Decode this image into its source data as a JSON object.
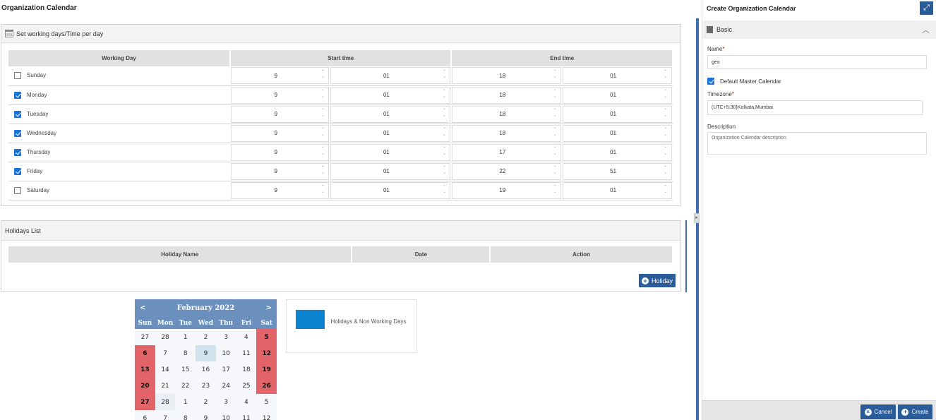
{
  "page_title": "Organization Calendar",
  "working_days": {
    "title": "Set working days/Time per day",
    "columns": [
      "Working Day",
      "Start time",
      "End time"
    ],
    "rows": [
      {
        "day": "Sunday",
        "checked": false,
        "start_hour": "9",
        "start_min": "01",
        "end_hour": "18",
        "end_min": "01"
      },
      {
        "day": "Monday",
        "checked": true,
        "start_hour": "9",
        "start_min": "01",
        "end_hour": "18",
        "end_min": "01"
      },
      {
        "day": "Tuesday",
        "checked": true,
        "start_hour": "9",
        "start_min": "01",
        "end_hour": "18",
        "end_min": "01"
      },
      {
        "day": "Wednesday",
        "checked": true,
        "start_hour": "9",
        "start_min": "01",
        "end_hour": "18",
        "end_min": "01"
      },
      {
        "day": "Thursday",
        "checked": true,
        "start_hour": "9",
        "start_min": "01",
        "end_hour": "17",
        "end_min": "01"
      },
      {
        "day": "Friday",
        "checked": true,
        "start_hour": "9",
        "start_min": "01",
        "end_hour": "22",
        "end_min": "51"
      },
      {
        "day": "Saturday",
        "checked": false,
        "start_hour": "9",
        "start_min": "01",
        "end_hour": "19",
        "end_min": "01"
      }
    ]
  },
  "holidays": {
    "title": "Holidays List",
    "columns": [
      "Holiday Name",
      "Date",
      "Action"
    ],
    "add_button": "Holiday"
  },
  "calendar": {
    "month_label": "February 2022",
    "prev": "<",
    "next": ">",
    "dow": [
      "Sun",
      "Mon",
      "Tue",
      "Wed",
      "Thu",
      "Fri",
      "Sat"
    ],
    "cells": [
      {
        "d": "27",
        "t": ""
      },
      {
        "d": "28",
        "t": ""
      },
      {
        "d": "1",
        "t": ""
      },
      {
        "d": "2",
        "t": ""
      },
      {
        "d": "3",
        "t": ""
      },
      {
        "d": "4",
        "t": ""
      },
      {
        "d": "5",
        "t": "hol"
      },
      {
        "d": "6",
        "t": "hol"
      },
      {
        "d": "7",
        "t": ""
      },
      {
        "d": "8",
        "t": ""
      },
      {
        "d": "9",
        "t": "sel"
      },
      {
        "d": "10",
        "t": ""
      },
      {
        "d": "11",
        "t": ""
      },
      {
        "d": "12",
        "t": "hol"
      },
      {
        "d": "13",
        "t": "hol"
      },
      {
        "d": "14",
        "t": ""
      },
      {
        "d": "15",
        "t": ""
      },
      {
        "d": "16",
        "t": ""
      },
      {
        "d": "17",
        "t": ""
      },
      {
        "d": "18",
        "t": ""
      },
      {
        "d": "19",
        "t": "hol"
      },
      {
        "d": "20",
        "t": "hol"
      },
      {
        "d": "21",
        "t": ""
      },
      {
        "d": "22",
        "t": ""
      },
      {
        "d": "23",
        "t": ""
      },
      {
        "d": "24",
        "t": ""
      },
      {
        "d": "25",
        "t": ""
      },
      {
        "d": "26",
        "t": "hol"
      },
      {
        "d": "27",
        "t": "hol"
      },
      {
        "d": "28",
        "t": "muted"
      },
      {
        "d": "1",
        "t": ""
      },
      {
        "d": "2",
        "t": ""
      },
      {
        "d": "3",
        "t": ""
      },
      {
        "d": "4",
        "t": ""
      },
      {
        "d": "5",
        "t": ""
      },
      {
        "d": "6",
        "t": ""
      },
      {
        "d": "7",
        "t": ""
      },
      {
        "d": "8",
        "t": ""
      },
      {
        "d": "9",
        "t": ""
      },
      {
        "d": "10",
        "t": ""
      },
      {
        "d": "11",
        "t": ""
      },
      {
        "d": "12",
        "t": ""
      }
    ]
  },
  "legend": {
    "text": ": Holidays & Non Working Days",
    "color": "#0b83cf"
  },
  "right_panel": {
    "title": "Create Organization Calendar",
    "section": "Basic",
    "name_label": "Name",
    "name_value": "geo",
    "default_master_label": "Default Master Calendar",
    "default_master_checked": true,
    "timezone_label": "Timezone",
    "timezone_value": "(UTC+5:30)Kolkata,Mumbai",
    "description_label": "Description",
    "description_placeholder": "Organization Calendar description",
    "cancel_label": "Cancel",
    "create_label": "Create"
  }
}
